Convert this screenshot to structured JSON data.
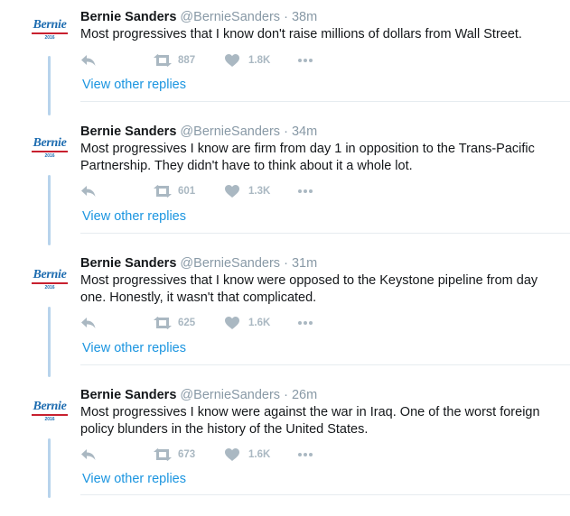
{
  "icons": {
    "reply": "reply-icon",
    "retweet": "retweet-icon",
    "like": "heart-icon",
    "more": "more-icon"
  },
  "colors": {
    "link": "#1b95e0",
    "muted": "#aab8c2",
    "thread_line": "#b7d3ec",
    "logo_blue": "#1d6cb0",
    "logo_red": "#c8202f"
  },
  "avatar": {
    "logo_text": "Bernie",
    "logo_year": "2016"
  },
  "tweets": [
    {
      "name": "Bernie Sanders",
      "handle": "@BernieSanders",
      "sep": "·",
      "time": "38m",
      "text": "Most progressives that I know don't raise millions of dollars from Wall Street.",
      "retweets": "887",
      "likes": "1.8K",
      "more_link": "View other replies"
    },
    {
      "name": "Bernie Sanders",
      "handle": "@BernieSanders",
      "sep": "·",
      "time": "34m",
      "text": "Most progressives I know are firm from day 1 in opposition to the Trans-Pacific Partnership. They didn't have to think about it a whole lot.",
      "retweets": "601",
      "likes": "1.3K",
      "more_link": "View other replies"
    },
    {
      "name": "Bernie Sanders",
      "handle": "@BernieSanders",
      "sep": "·",
      "time": "31m",
      "text": "Most progressives that I know were opposed to the Keystone pipeline from day one. Honestly, it wasn't that complicated.",
      "retweets": "625",
      "likes": "1.6K",
      "more_link": "View other replies"
    },
    {
      "name": "Bernie Sanders",
      "handle": "@BernieSanders",
      "sep": "·",
      "time": "26m",
      "text": "Most progressives I know were against the war in Iraq. One of the worst foreign policy blunders in the history of the United States.",
      "retweets": "673",
      "likes": "1.6K",
      "more_link": "View other replies"
    }
  ]
}
